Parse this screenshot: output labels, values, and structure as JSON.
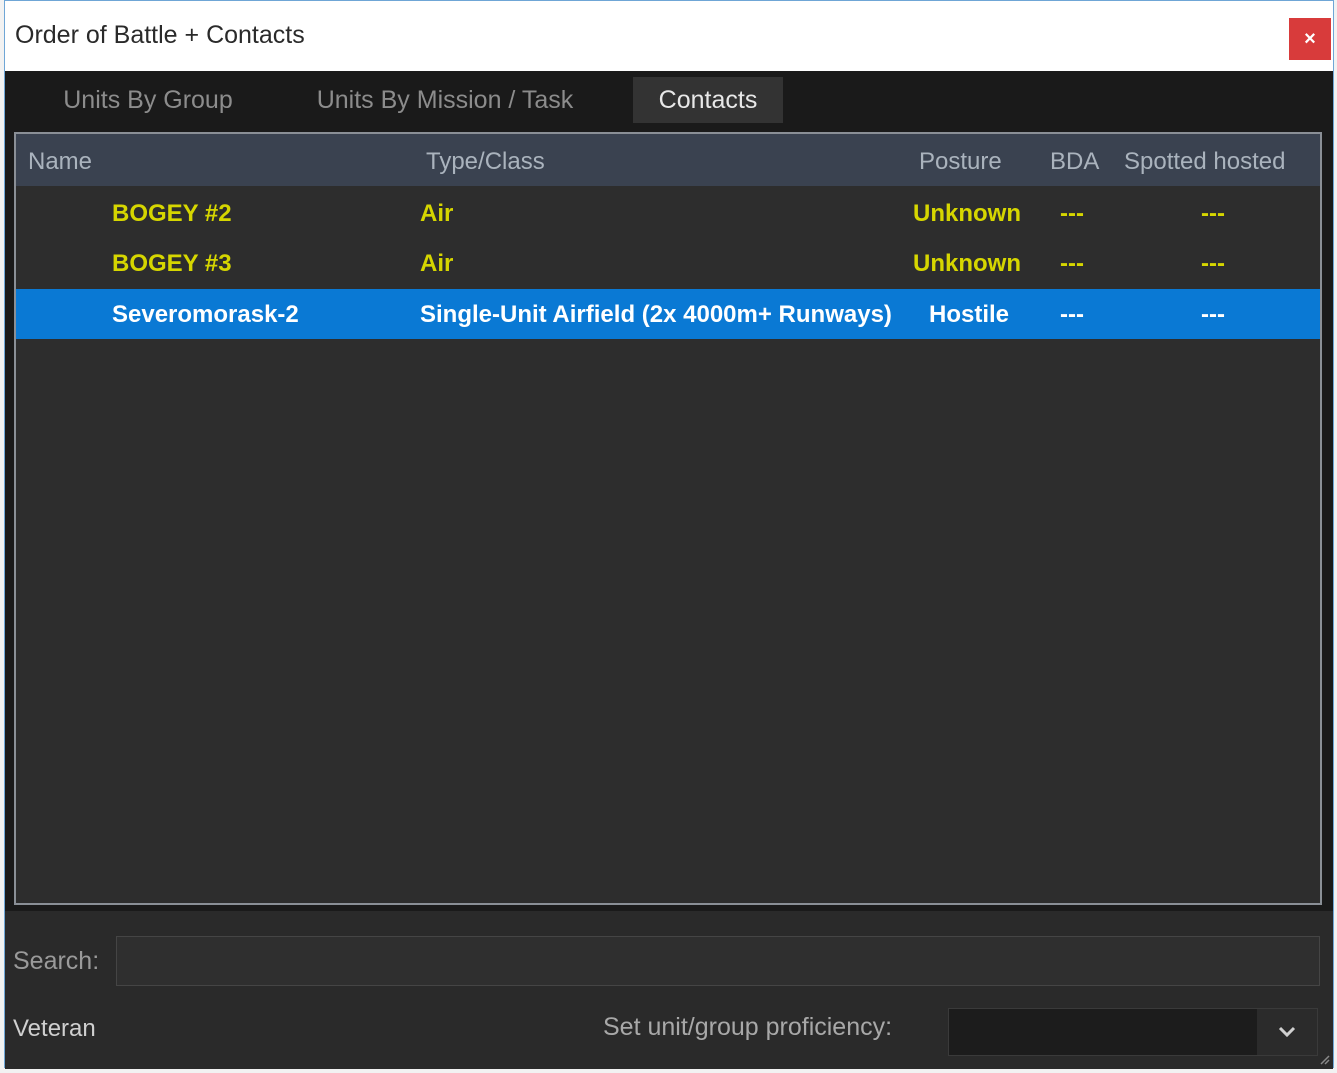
{
  "window": {
    "title": "Order of Battle + Contacts",
    "close_glyph": "×"
  },
  "tabs": [
    {
      "label": "Units By Group"
    },
    {
      "label": "Units By Mission / Task"
    },
    {
      "label": "Contacts"
    }
  ],
  "table": {
    "headers": {
      "name": "Name",
      "type": "Type/Class",
      "posture": "Posture",
      "bda": "BDA",
      "spotted": "Spotted hosted"
    },
    "rows": [
      {
        "name": "BOGEY #2",
        "type": "Air",
        "posture": "Unknown",
        "bda": "---",
        "spotted": "---"
      },
      {
        "name": "BOGEY #3",
        "type": "Air",
        "posture": "Unknown",
        "bda": "---",
        "spotted": "---"
      },
      {
        "name": "Severomorask-2",
        "type": "Single-Unit Airfield (2x 4000m+ Runways)",
        "posture": "Hostile",
        "bda": "---",
        "spotted": "---"
      }
    ]
  },
  "footer": {
    "search_label": "Search:",
    "search_value": "",
    "proficiency_value_label": "Veteran",
    "proficiency_label": "Set unit/group proficiency:",
    "proficiency_selected": "",
    "dropdown_icon": "chevron-down-icon",
    "resize_icon": "resize-grip-icon"
  },
  "colors": {
    "contact_text": "#d6d600",
    "selected_row_bg": "#0a79d4",
    "close_button": "#d83b3b"
  }
}
